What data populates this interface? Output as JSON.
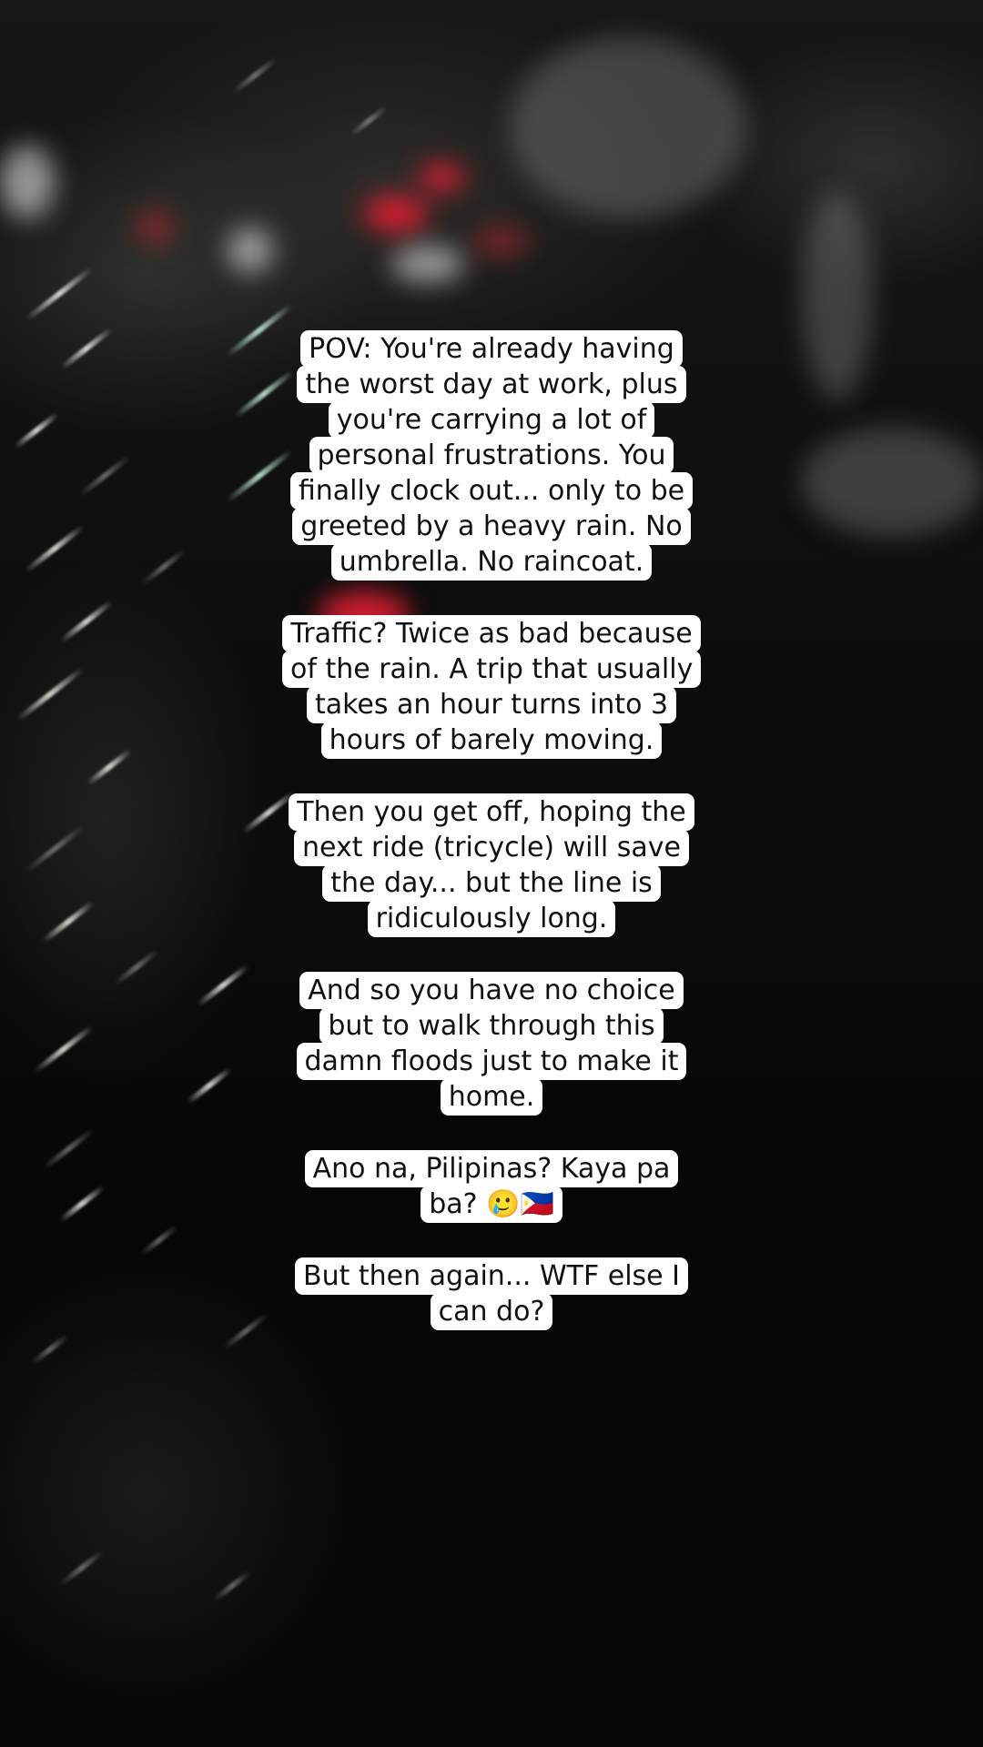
{
  "captions": [
    "POV: You're already having the worst day at work, plus you're carrying a lot of personal frustrations. You finally clock out... only to be greeted by a heavy rain. No umbrella. No raincoat.",
    "Traffic? Twice as bad because of the rain. A trip that usually takes an hour turns into 3 hours of barely moving.",
    "Then you get off, hoping the next ride (tricycle) will save the day... but the line is ridiculously long.",
    "And so you have no choice but to walk through this damn floods just to make it home.",
    "Ano na, Pilipinas? Kaya pa ba? 🥲🇵🇭",
    "But then again... WTF else I can do?"
  ],
  "colors": {
    "caption_background": "#ffffff",
    "caption_text": "#111111",
    "scene_dark": "#070807",
    "light_red": "#e61e32"
  }
}
